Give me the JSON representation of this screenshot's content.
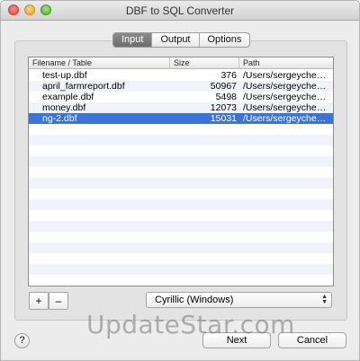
{
  "window": {
    "title": "DBF to SQL Converter"
  },
  "tabs": [
    {
      "label": "Input",
      "active": true
    },
    {
      "label": "Output",
      "active": false
    },
    {
      "label": "Options",
      "active": false
    }
  ],
  "table": {
    "columns": [
      "Filename / Table",
      "Size",
      "Path"
    ],
    "rows": [
      {
        "name": "test-up.dbf",
        "size": "376",
        "path": "/Users/sergeyche…",
        "selected": false
      },
      {
        "name": "april_farmreport.dbf",
        "size": "50967",
        "path": "/Users/sergeyche…",
        "selected": false
      },
      {
        "name": "example.dbf",
        "size": "5498",
        "path": "/Users/sergeyche…",
        "selected": false
      },
      {
        "name": "money.dbf",
        "size": "12073",
        "path": "/Users/sergeyche…",
        "selected": false
      },
      {
        "name": "ng-2.dbf",
        "size": "15031",
        "path": "/Users/sergeyche…",
        "selected": true
      }
    ]
  },
  "controls": {
    "add_label": "+",
    "remove_label": "–",
    "encoding_value": "Cyrillic (Windows)",
    "help_label": "?",
    "next_label": "Next",
    "cancel_label": "Cancel"
  },
  "watermark": "UpdateStar.com",
  "colors": {
    "selection": "#3b74d6"
  }
}
